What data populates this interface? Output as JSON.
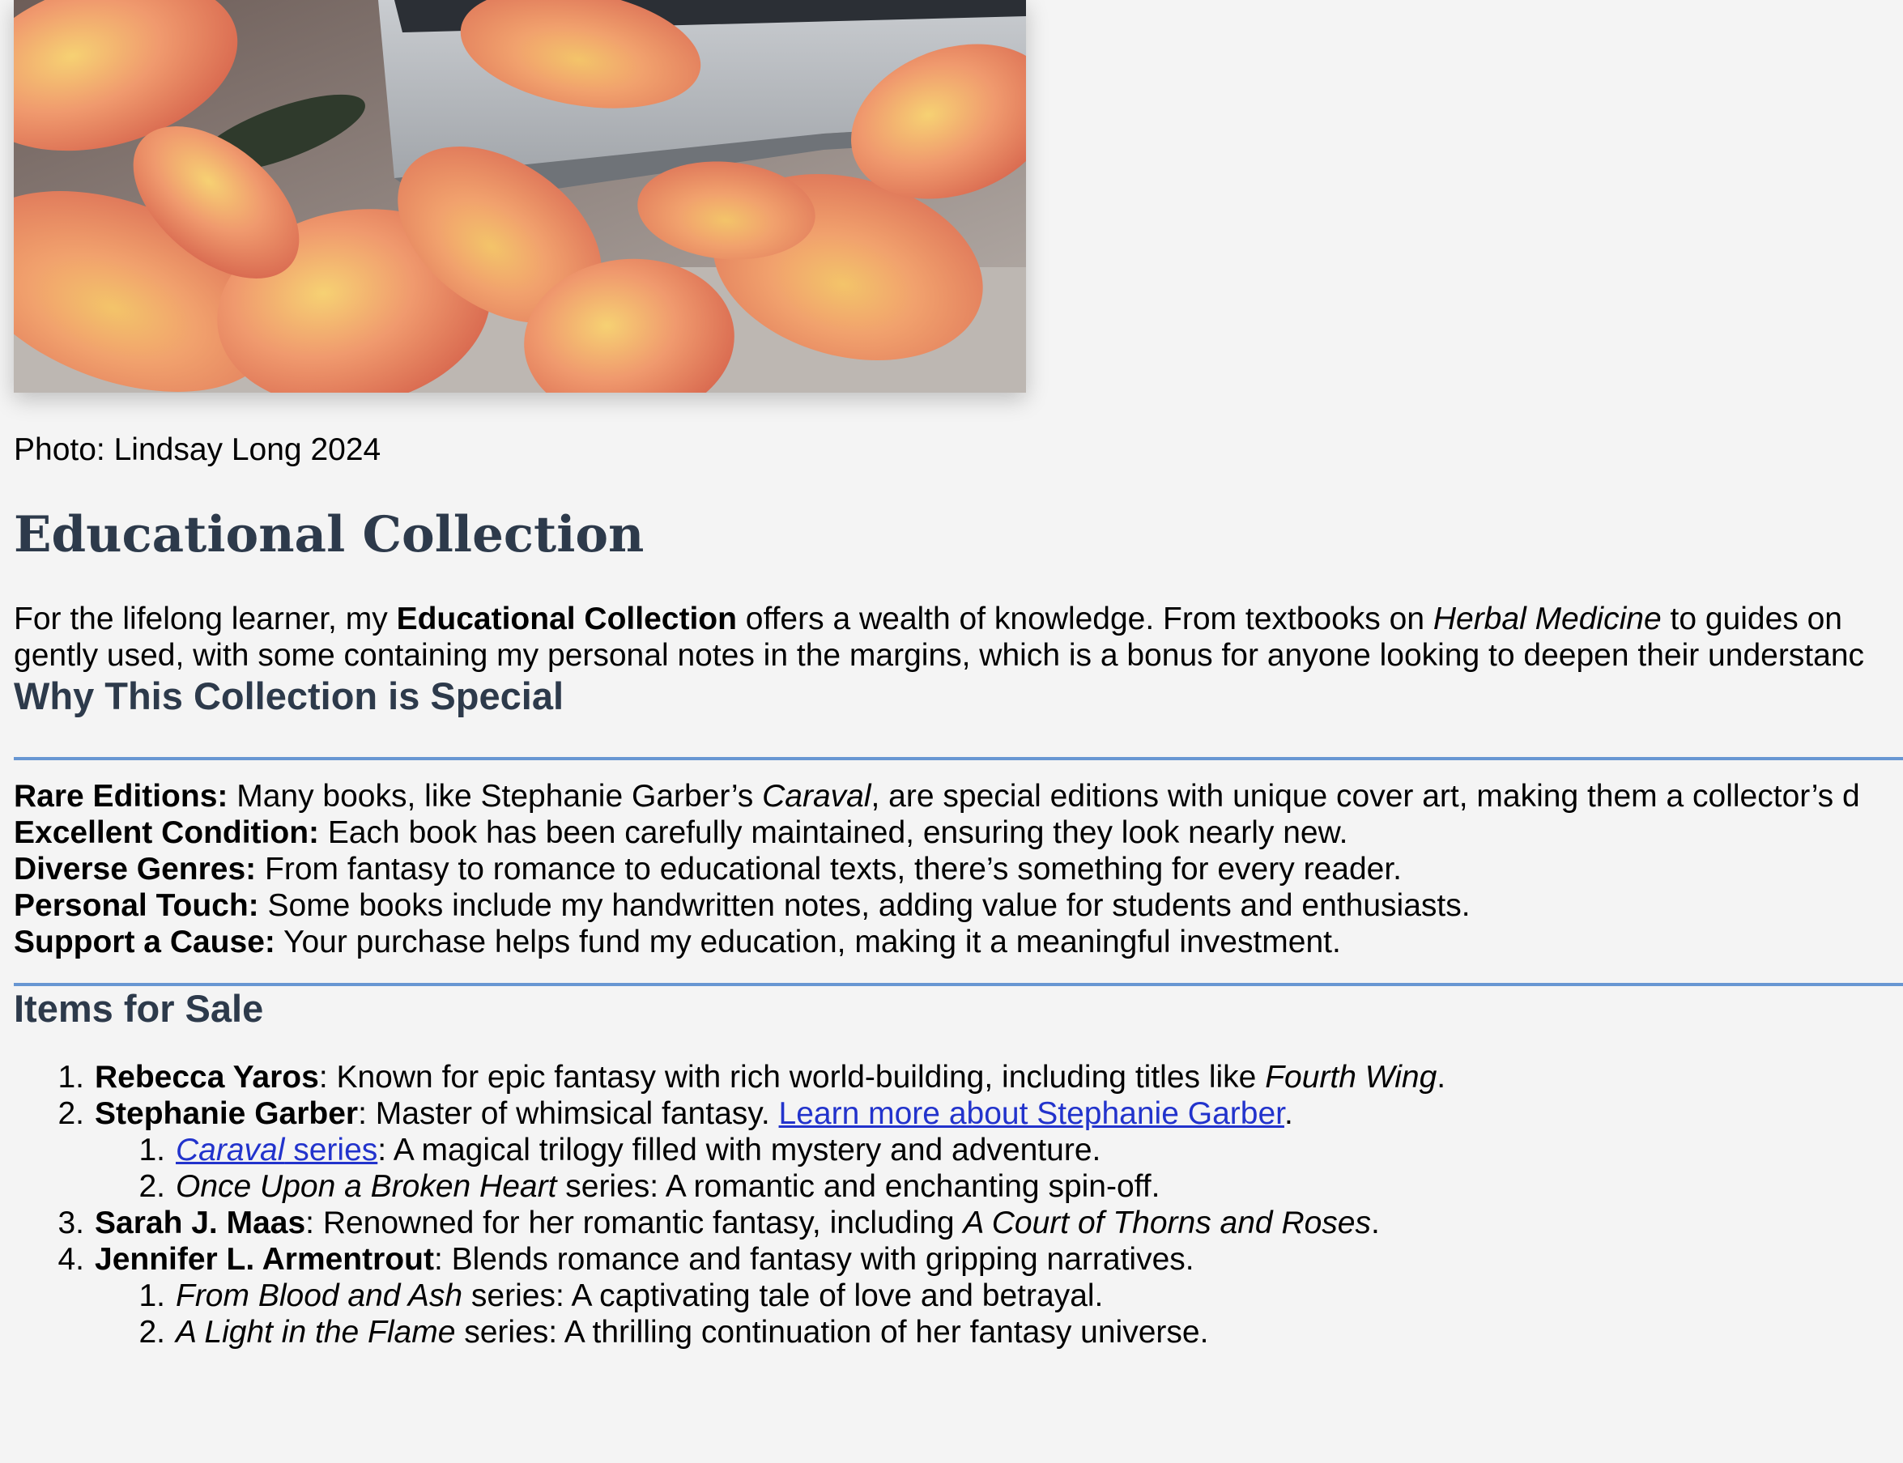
{
  "photo": {
    "alt": "Orange and yellow rose petals scattered around stacked books"
  },
  "caption": "Photo: Lindsay Long 2024",
  "title": "Educational Collection",
  "intro": {
    "line1_a": "For the lifelong learner, my ",
    "line1_b": "Educational Collection",
    "line1_c": " offers a wealth of knowledge. From textbooks on ",
    "line1_d": "Herbal Medicine",
    "line1_e": " to guides on ",
    "line2": "gently used, with some containing my personal notes in the margins, which is a bonus for anyone looking to deepen their understanc"
  },
  "why": {
    "heading": "Why This Collection is Special",
    "features": [
      {
        "label": "Rare Editions:",
        "a": " Many books, like Stephanie Garber’s ",
        "em": "Caraval",
        "b": ", are special editions with unique cover art, making them a collector’s d"
      },
      {
        "label": "Excellent Condition:",
        "text": " Each book has been carefully maintained, ensuring they look nearly new."
      },
      {
        "label": "Diverse Genres:",
        "text": " From fantasy to romance to educational texts, there’s something for every reader."
      },
      {
        "label": "Personal Touch:",
        "text": " Some books include my handwritten notes, adding value for students and enthusiasts."
      },
      {
        "label": "Support a Cause:",
        "text": " Your purchase helps fund my education, making it a meaningful investment."
      }
    ]
  },
  "items": {
    "heading": "Items for Sale",
    "list": [
      {
        "num": "1.",
        "author": "Rebecca Yaros",
        "a": ": Known for epic fantasy with rich world-building, including titles like ",
        "em": "Fourth Wing",
        "b": "."
      },
      {
        "num": "2.",
        "author": "Stephanie Garber",
        "a": ": Master of whimsical fantasy. ",
        "link": "Learn more about Stephanie Garber",
        "b": ".",
        "sub": [
          {
            "num": "1.",
            "link_em": "Caraval",
            "link_rest": " series",
            "text": ": A magical trilogy filled with mystery and adventure."
          },
          {
            "num": "2.",
            "em": "Once Upon a Broken Heart",
            "text": " series: A romantic and enchanting spin-off."
          }
        ]
      },
      {
        "num": "3.",
        "author": "Sarah J. Maas",
        "a": ": Renowned for her romantic fantasy, including ",
        "em": "A Court of Thorns and Roses",
        "b": "."
      },
      {
        "num": "4.",
        "author": "Jennifer L. Armentrout",
        "a": ": Blends romance and fantasy with gripping narratives.",
        "b": "",
        "sub": [
          {
            "num": "1.",
            "em": "From Blood and Ash",
            "text": " series: A captivating tale of love and betrayal."
          },
          {
            "num": "2.",
            "em": "A Light in the Flame",
            "text": " series: A thrilling continuation of her fantasy universe."
          }
        ]
      }
    ]
  },
  "colors": {
    "background": "#f4f4f4",
    "heading": "#2d3a4b",
    "rule": "#6796d2",
    "link": "#2233cc"
  }
}
